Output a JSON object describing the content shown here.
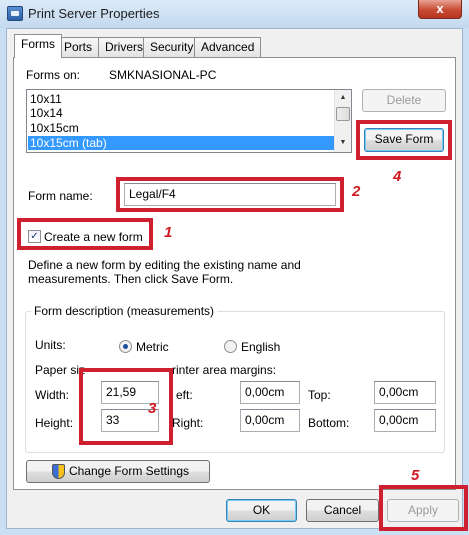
{
  "window": {
    "title": "Print Server Properties",
    "close_glyph": "x"
  },
  "tabs": [
    {
      "label": "Forms",
      "active": true
    },
    {
      "label": "Ports",
      "active": false
    },
    {
      "label": "Drivers",
      "active": false
    },
    {
      "label": "Security",
      "active": false
    },
    {
      "label": "Advanced",
      "active": false
    }
  ],
  "forms_on": {
    "label": "Forms on:",
    "value": "SMKNASIONAL-PC"
  },
  "form_list": {
    "items": [
      "10x11",
      "10x14",
      "10x15cm",
      "10x15cm (tab)"
    ],
    "selected_index": 3
  },
  "buttons": {
    "delete": "Delete",
    "save_form": "Save Form",
    "change_form_settings": "Change Form Settings",
    "ok": "OK",
    "cancel": "Cancel",
    "apply": "Apply"
  },
  "form_name": {
    "label": "Form name:",
    "value": "Legal/F4"
  },
  "create_new_form": {
    "label": "Create a new form",
    "checked": true
  },
  "instructions": {
    "line1": "Define a new form by editing the existing name and",
    "line2": "measurements. Then click Save Form."
  },
  "form_description": {
    "title": "Form description (measurements)",
    "units_label": "Units:",
    "units_options": [
      {
        "label": "Metric",
        "selected": true
      },
      {
        "label": "English",
        "selected": false
      }
    ],
    "paper_size_label": "Paper siz",
    "printer_margins_label": "rinter area margins:",
    "width": {
      "label": "Width:",
      "value": "21,59"
    },
    "height": {
      "label": "Height:",
      "value": "33"
    },
    "left": {
      "label": "eft:",
      "value": "0,00cm"
    },
    "right": {
      "label": "Right:",
      "value": "0,00cm"
    },
    "top": {
      "label": "Top:",
      "value": "0,00cm"
    },
    "bottom": {
      "label": "Bottom:",
      "value": "0,00cm"
    }
  },
  "annotations": {
    "step1": "1",
    "step2": "2",
    "step3": "3",
    "step4": "4",
    "step5": "5",
    "highlight_color": "#cf2030"
  },
  "icons": {
    "title_icon": "printer-server-icon",
    "shield_icon": "uac-shield-icon"
  }
}
